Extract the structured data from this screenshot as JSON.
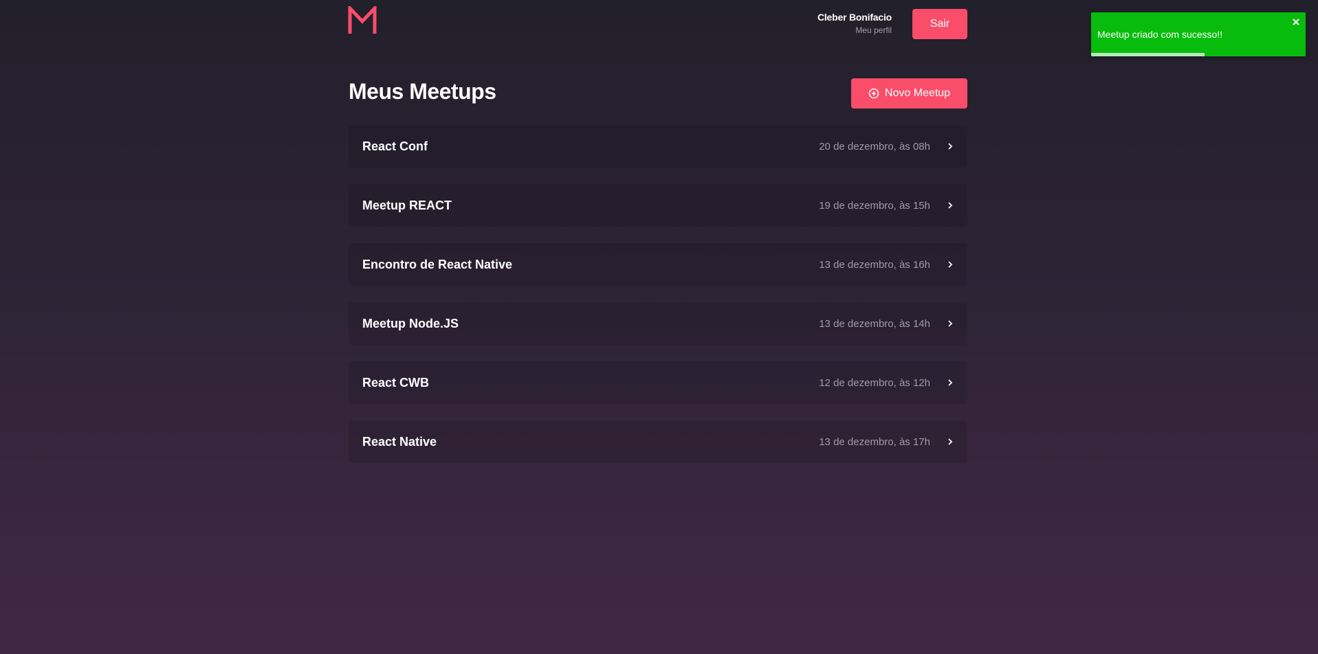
{
  "header": {
    "logo_letter": "M",
    "user_name": "Cleber Bonifacio",
    "profile_link": "Meu perfil",
    "logout_label": "Sair"
  },
  "main": {
    "title": "Meus Meetups",
    "new_button_label": "Novo Meetup",
    "meetups": [
      {
        "title": "React Conf",
        "date": "20 de dezembro, às 08h"
      },
      {
        "title": "Meetup REACT",
        "date": "19 de dezembro, às 15h"
      },
      {
        "title": "Encontro de React Native",
        "date": "13 de dezembro, às 16h"
      },
      {
        "title": "Meetup Node.JS",
        "date": "13 de dezembro, às 14h"
      },
      {
        "title": "React CWB",
        "date": "12 de dezembro, às 12h"
      },
      {
        "title": "React Native",
        "date": "13 de dezembro, às 17h"
      }
    ]
  },
  "toast": {
    "message": "Meetup criado com sucesso!!",
    "progress_percent": 53,
    "color": "#07bc0c"
  },
  "colors": {
    "accent": "#f94d6a",
    "background_top": "#22202b",
    "background_bottom": "#402844"
  },
  "icons": {
    "logo": "meetapp-logo-icon",
    "new_meetup": "plus-circle-icon",
    "item_arrow": "chevron-right-icon",
    "toast_close": "close-icon"
  }
}
